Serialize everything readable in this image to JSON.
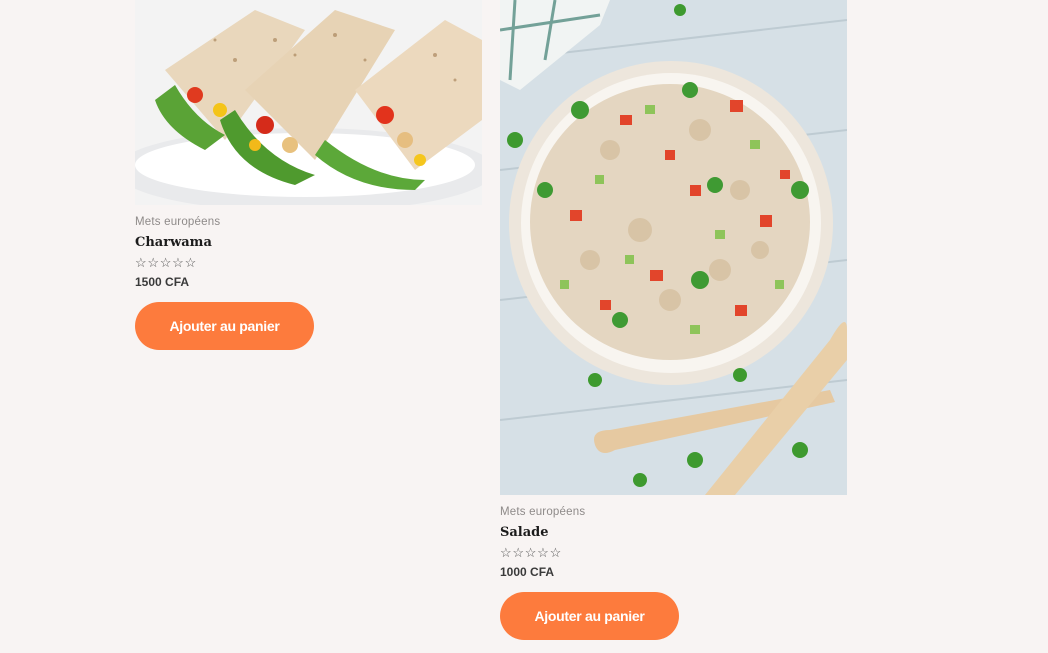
{
  "products": [
    {
      "category": "Mets européens",
      "name": "Charwama",
      "rating_stars": [
        "☆",
        "☆",
        "☆",
        "☆",
        "☆"
      ],
      "rating": 0,
      "price": "1500 CFA",
      "cta": "Ajouter au panier"
    },
    {
      "category": "Mets européens",
      "name": "Salade",
      "rating_stars": [
        "☆",
        "☆",
        "☆",
        "☆",
        "☆"
      ],
      "rating": 0,
      "price": "1000 CFA",
      "cta": "Ajouter au panier"
    }
  ],
  "colors": {
    "background": "#f8f4f3",
    "accent": "#fd7b3d",
    "category_text": "#8e8a89",
    "title_text": "#1b1b1b"
  }
}
